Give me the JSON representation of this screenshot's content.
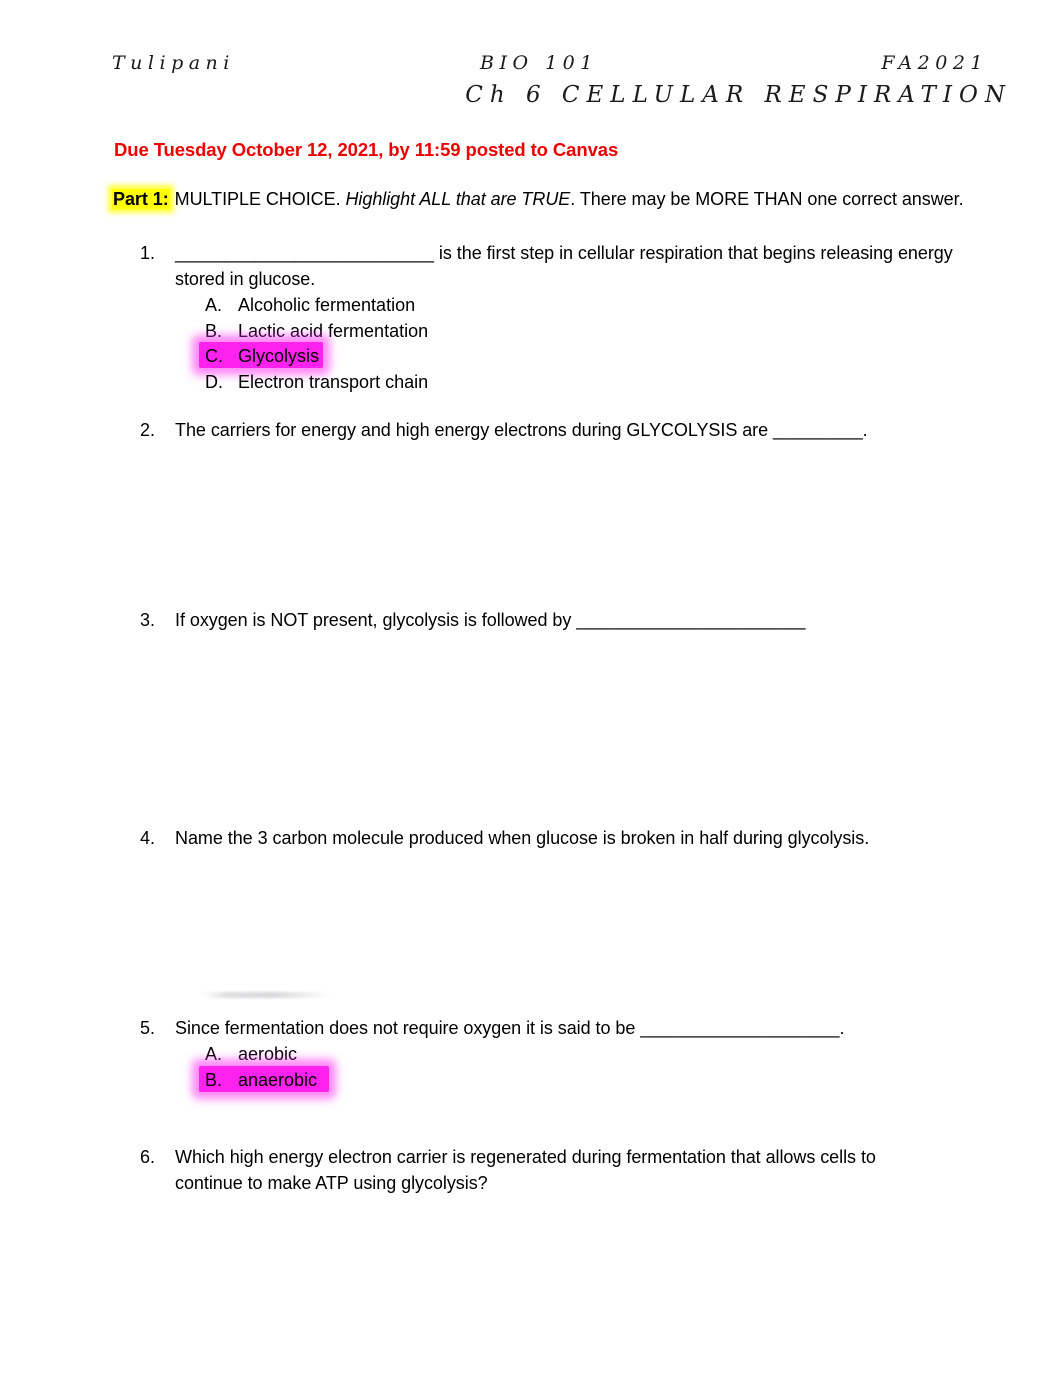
{
  "header": {
    "author": "Tulipani",
    "course": "BIO 101",
    "term": "FA2021",
    "title": "Ch 6 CELLULAR RESPIRATION"
  },
  "due_notice": "Due Tuesday October 12, 2021, by 11:59 posted to Canvas",
  "instructions": {
    "part_label": "Part 1:",
    "lead": " MULTIPLE CHOICE. ",
    "emphasis": "Highlight ALL that are TRUE",
    "tail": ". There may be MORE THAN one correct answer."
  },
  "colors": {
    "due_red": "#ee0000",
    "highlight_yellow": "#ffff00",
    "highlight_magenta": "#ff22ee",
    "text_black": "#000000",
    "page_background": "#ffffff"
  },
  "questions": [
    {
      "number": "1.",
      "text_line1": "__________________________ is the first step in cellular respiration that begins releasing energy",
      "text_line2": "stored in glucose.",
      "options": [
        {
          "letter": "A.",
          "text": "Alcoholic fermentation",
          "highlight": "none"
        },
        {
          "letter": "B.",
          "text": "Lactic acid fermentation",
          "highlight": "none"
        },
        {
          "letter": "C.",
          "text": "Glycolysis",
          "highlight": "magenta"
        },
        {
          "letter": "D.",
          "text": "Electron transport chain",
          "highlight": "none"
        }
      ]
    },
    {
      "number": "2.",
      "text_line1": "The carriers for energy and high energy electrons during GLYCOLYSIS are _________.",
      "text_line2": "",
      "options": []
    },
    {
      "number": "3.",
      "text_line1": "If oxygen is NOT present, glycolysis is followed by _______________________",
      "text_line2": "",
      "options": []
    },
    {
      "number": "4.",
      "text_line1": "Name the 3 carbon molecule produced when glucose is broken in half during glycolysis.",
      "text_line2": "",
      "options": []
    },
    {
      "number": "5.",
      "text_line1": "Since fermentation does not require oxygen it is said to be ____________________.",
      "text_line2": "",
      "options": [
        {
          "letter": "A.",
          "text": "aerobic",
          "highlight": "none"
        },
        {
          "letter": "B.",
          "text": "anaerobic",
          "highlight": "magenta"
        }
      ]
    },
    {
      "number": "6.",
      "text_line1": "Which high energy electron carrier is regenerated during fermentation that allows cells to",
      "text_line2": "continue to make ATP using glycolysis?",
      "options": []
    }
  ]
}
